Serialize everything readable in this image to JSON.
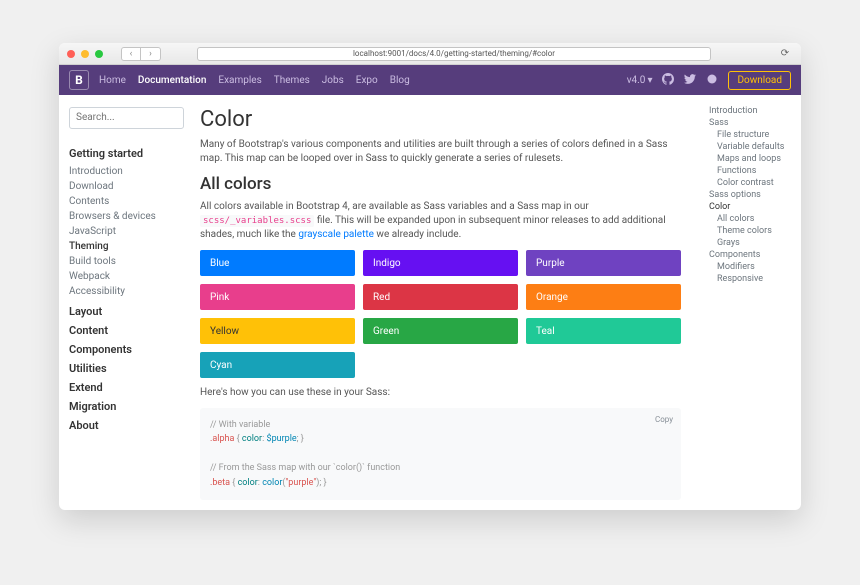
{
  "browser": {
    "url": "localhost:9001/docs/4.0/getting-started/theming/#color"
  },
  "nav": {
    "brand": "B",
    "links": [
      "Home",
      "Documentation",
      "Examples",
      "Themes",
      "Jobs",
      "Expo",
      "Blog"
    ],
    "active": "Documentation",
    "version": "v4.0",
    "download": "Download"
  },
  "sidebar": {
    "search_placeholder": "Search...",
    "sections": [
      {
        "head": "Getting started",
        "items": [
          "Introduction",
          "Download",
          "Contents",
          "Browsers & devices",
          "JavaScript",
          "Theming",
          "Build tools",
          "Webpack",
          "Accessibility"
        ],
        "active": "Theming"
      },
      {
        "head": "Layout"
      },
      {
        "head": "Content"
      },
      {
        "head": "Components"
      },
      {
        "head": "Utilities"
      },
      {
        "head": "Extend"
      },
      {
        "head": "Migration"
      },
      {
        "head": "About"
      }
    ]
  },
  "main": {
    "h1": "Color",
    "intro": "Many of Bootstrap's various components and utilities are built through a series of colors defined in a Sass map. This map can be looped over in Sass to quickly generate a series of rulesets.",
    "h2": "All colors",
    "allcolors_pre": "All colors available in Bootstrap 4, are available as Sass variables and a Sass map in our ",
    "scss_file": "scss/_variables.scss",
    "allcolors_mid": " file. This will be expanded upon in subsequent minor releases to add additional shades, much like the ",
    "palette_link": "grayscale palette",
    "allcolors_post": " we already include.",
    "swatches": [
      {
        "name": "Blue",
        "color": "#007bff"
      },
      {
        "name": "Indigo",
        "color": "#6610f2"
      },
      {
        "name": "Purple",
        "color": "#6f42c1"
      },
      {
        "name": "Pink",
        "color": "#e83e8c"
      },
      {
        "name": "Red",
        "color": "#dc3545"
      },
      {
        "name": "Orange",
        "color": "#fd7e14"
      },
      {
        "name": "Yellow",
        "color": "#ffc107",
        "dark": true
      },
      {
        "name": "Green",
        "color": "#28a745"
      },
      {
        "name": "Teal",
        "color": "#20c997"
      },
      {
        "name": "Cyan",
        "color": "#17a2b8"
      }
    ],
    "usage": "Here's how you can use these in your Sass:",
    "code": {
      "copy": "Copy",
      "c1": "// With variable",
      "l1_sel": ".alpha",
      "l1_open": " { ",
      "l1_prop": "color",
      "l1_mid": ": ",
      "l1_val": "$purple",
      "l1_close": "; }",
      "c2": "// From the Sass map with our `color()` function",
      "l2_sel": ".beta",
      "l2_open": " { ",
      "l2_prop": "color",
      "l2_mid": ": ",
      "l2_fn": "color",
      "l2_p1": "(",
      "l2_arg": "\"purple\"",
      "l2_p2": "); }"
    }
  },
  "toc": [
    {
      "t": "Introduction"
    },
    {
      "t": "Sass"
    },
    {
      "t": "File structure",
      "s": 1
    },
    {
      "t": "Variable defaults",
      "s": 1
    },
    {
      "t": "Maps and loops",
      "s": 1
    },
    {
      "t": "Functions",
      "s": 1
    },
    {
      "t": "Color contrast",
      "s": 1
    },
    {
      "t": "Sass options"
    },
    {
      "t": "Color",
      "a": 1
    },
    {
      "t": "All colors",
      "s": 1
    },
    {
      "t": "Theme colors",
      "s": 1
    },
    {
      "t": "Grays",
      "s": 1
    },
    {
      "t": "Components"
    },
    {
      "t": "Modifiers",
      "s": 1
    },
    {
      "t": "Responsive",
      "s": 1
    }
  ]
}
